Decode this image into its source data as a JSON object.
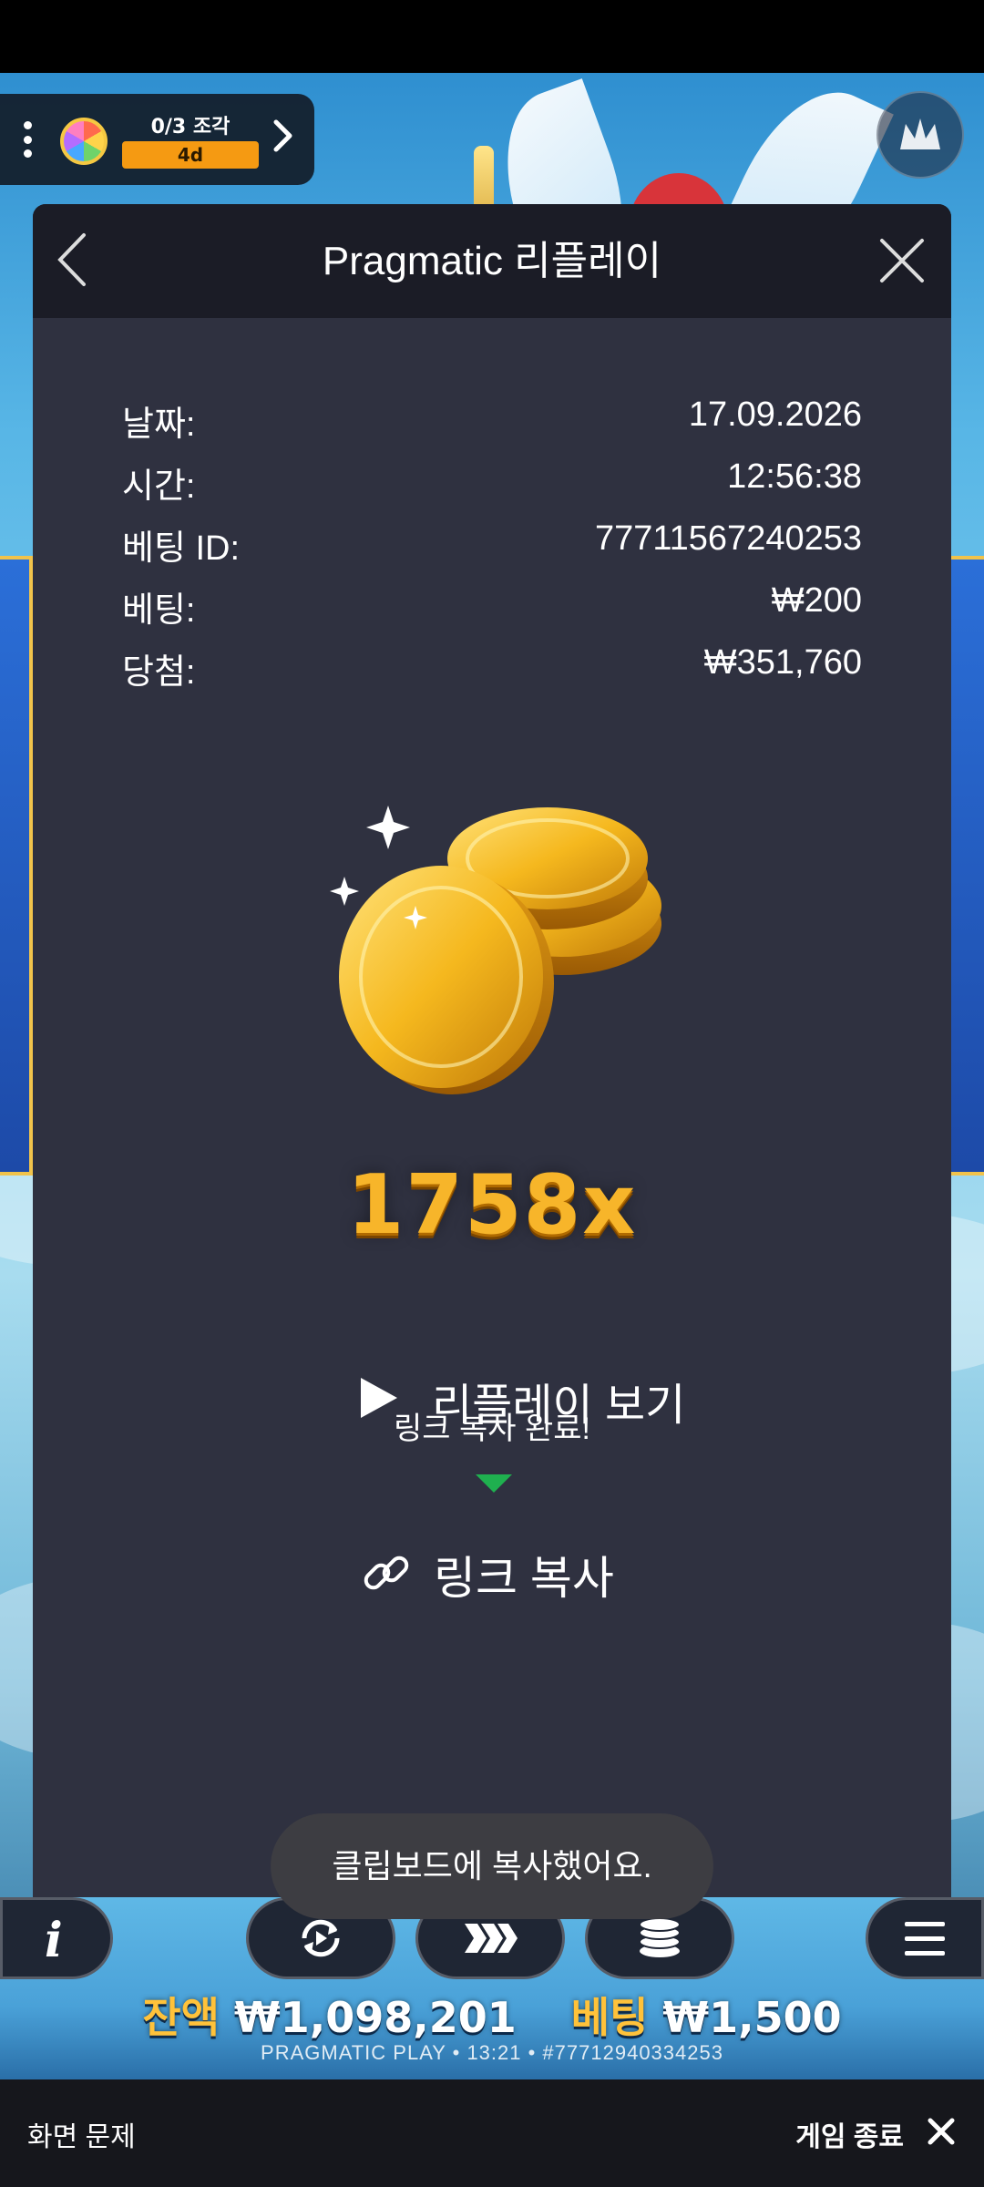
{
  "quest": {
    "progress": "0/3 조각",
    "timer": "4d"
  },
  "modal": {
    "title": "Pragmatic 리플레이",
    "rows": [
      {
        "label": "날짜:",
        "value": "17.09.2026"
      },
      {
        "label": "시간:",
        "value": "12:56:38"
      },
      {
        "label": "베팅 ID:",
        "value": "77711567240253"
      },
      {
        "label": "베팅:",
        "value": "₩200"
      },
      {
        "label": "당첨:",
        "value": "₩351,760"
      }
    ],
    "multiplier": "1758x",
    "replay_label": "리플레이 보기",
    "copied_tooltip": "링크 복사 완료!",
    "copy_link_label": "링크 복사"
  },
  "toast": "클립보드에 복사했어요.",
  "controls": {
    "info_glyph": "i",
    "balance_label": "잔액",
    "balance_value": "₩1,098,201",
    "bet_label": "베팅",
    "bet_value": "₩1,500",
    "footer": "PRAGMATIC PLAY • 13:21 • #77712940334253"
  },
  "bottom_bar": {
    "report_label": "화면 문제",
    "exit_label": "게임 종료"
  },
  "icons": {
    "menu_dots": "kebab-dots-icon",
    "wheel": "prize-wheel-icon",
    "quest_arrow": "chevron-right-icon",
    "corner": "crown-icon",
    "back": "chevron-left-icon",
    "close": "close-icon",
    "play": "play-icon",
    "link": "link-icon",
    "autoplay": "autoplay-icon",
    "turbo": "turbo-icon",
    "bet": "coin-stack-icon",
    "menu": "hamburger-icon",
    "exit": "close-icon"
  },
  "colors": {
    "modal_bg": "#2f3140",
    "header_bg": "#1b1c26",
    "timer_bg": "#f59a12",
    "gold": "#f7b52a",
    "tooltip_arrow": "#1fb04f",
    "balance_label": "#ffc23a"
  }
}
